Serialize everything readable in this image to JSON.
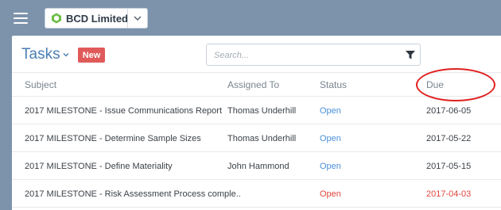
{
  "company": {
    "name": "BCD Limited"
  },
  "header": {
    "title": "Tasks",
    "new_label": "New",
    "search_placeholder": "Search..."
  },
  "columns": {
    "subject": "Subject",
    "assigned": "Assigned To",
    "status": "Status",
    "due": "Due"
  },
  "rows": [
    {
      "subject": "2017 MILESTONE - Issue Communications Report",
      "assigned": "Thomas Underhill",
      "status": "Open",
      "due": "2017-06-05"
    },
    {
      "subject": "2017 MILESTONE - Determine Sample Sizes",
      "assigned": "Thomas Underhill",
      "status": "Open",
      "due": "2017-05-22"
    },
    {
      "subject": "2017 MILESTONE - Define Materiality",
      "assigned": "John Hammond",
      "status": "Open",
      "due": "2017-05-15"
    },
    {
      "subject": "2017 MILESTONE - Risk Assessment Process comple..",
      "assigned": "",
      "status": "Open",
      "due": "2017-04-03"
    }
  ],
  "colors": {
    "brand_green": "#6cbd45",
    "link_blue": "#4a90d9",
    "overdue_red": "#e0463f",
    "new_button": "#e05a5a",
    "annotation_circle": "#e0201f"
  }
}
